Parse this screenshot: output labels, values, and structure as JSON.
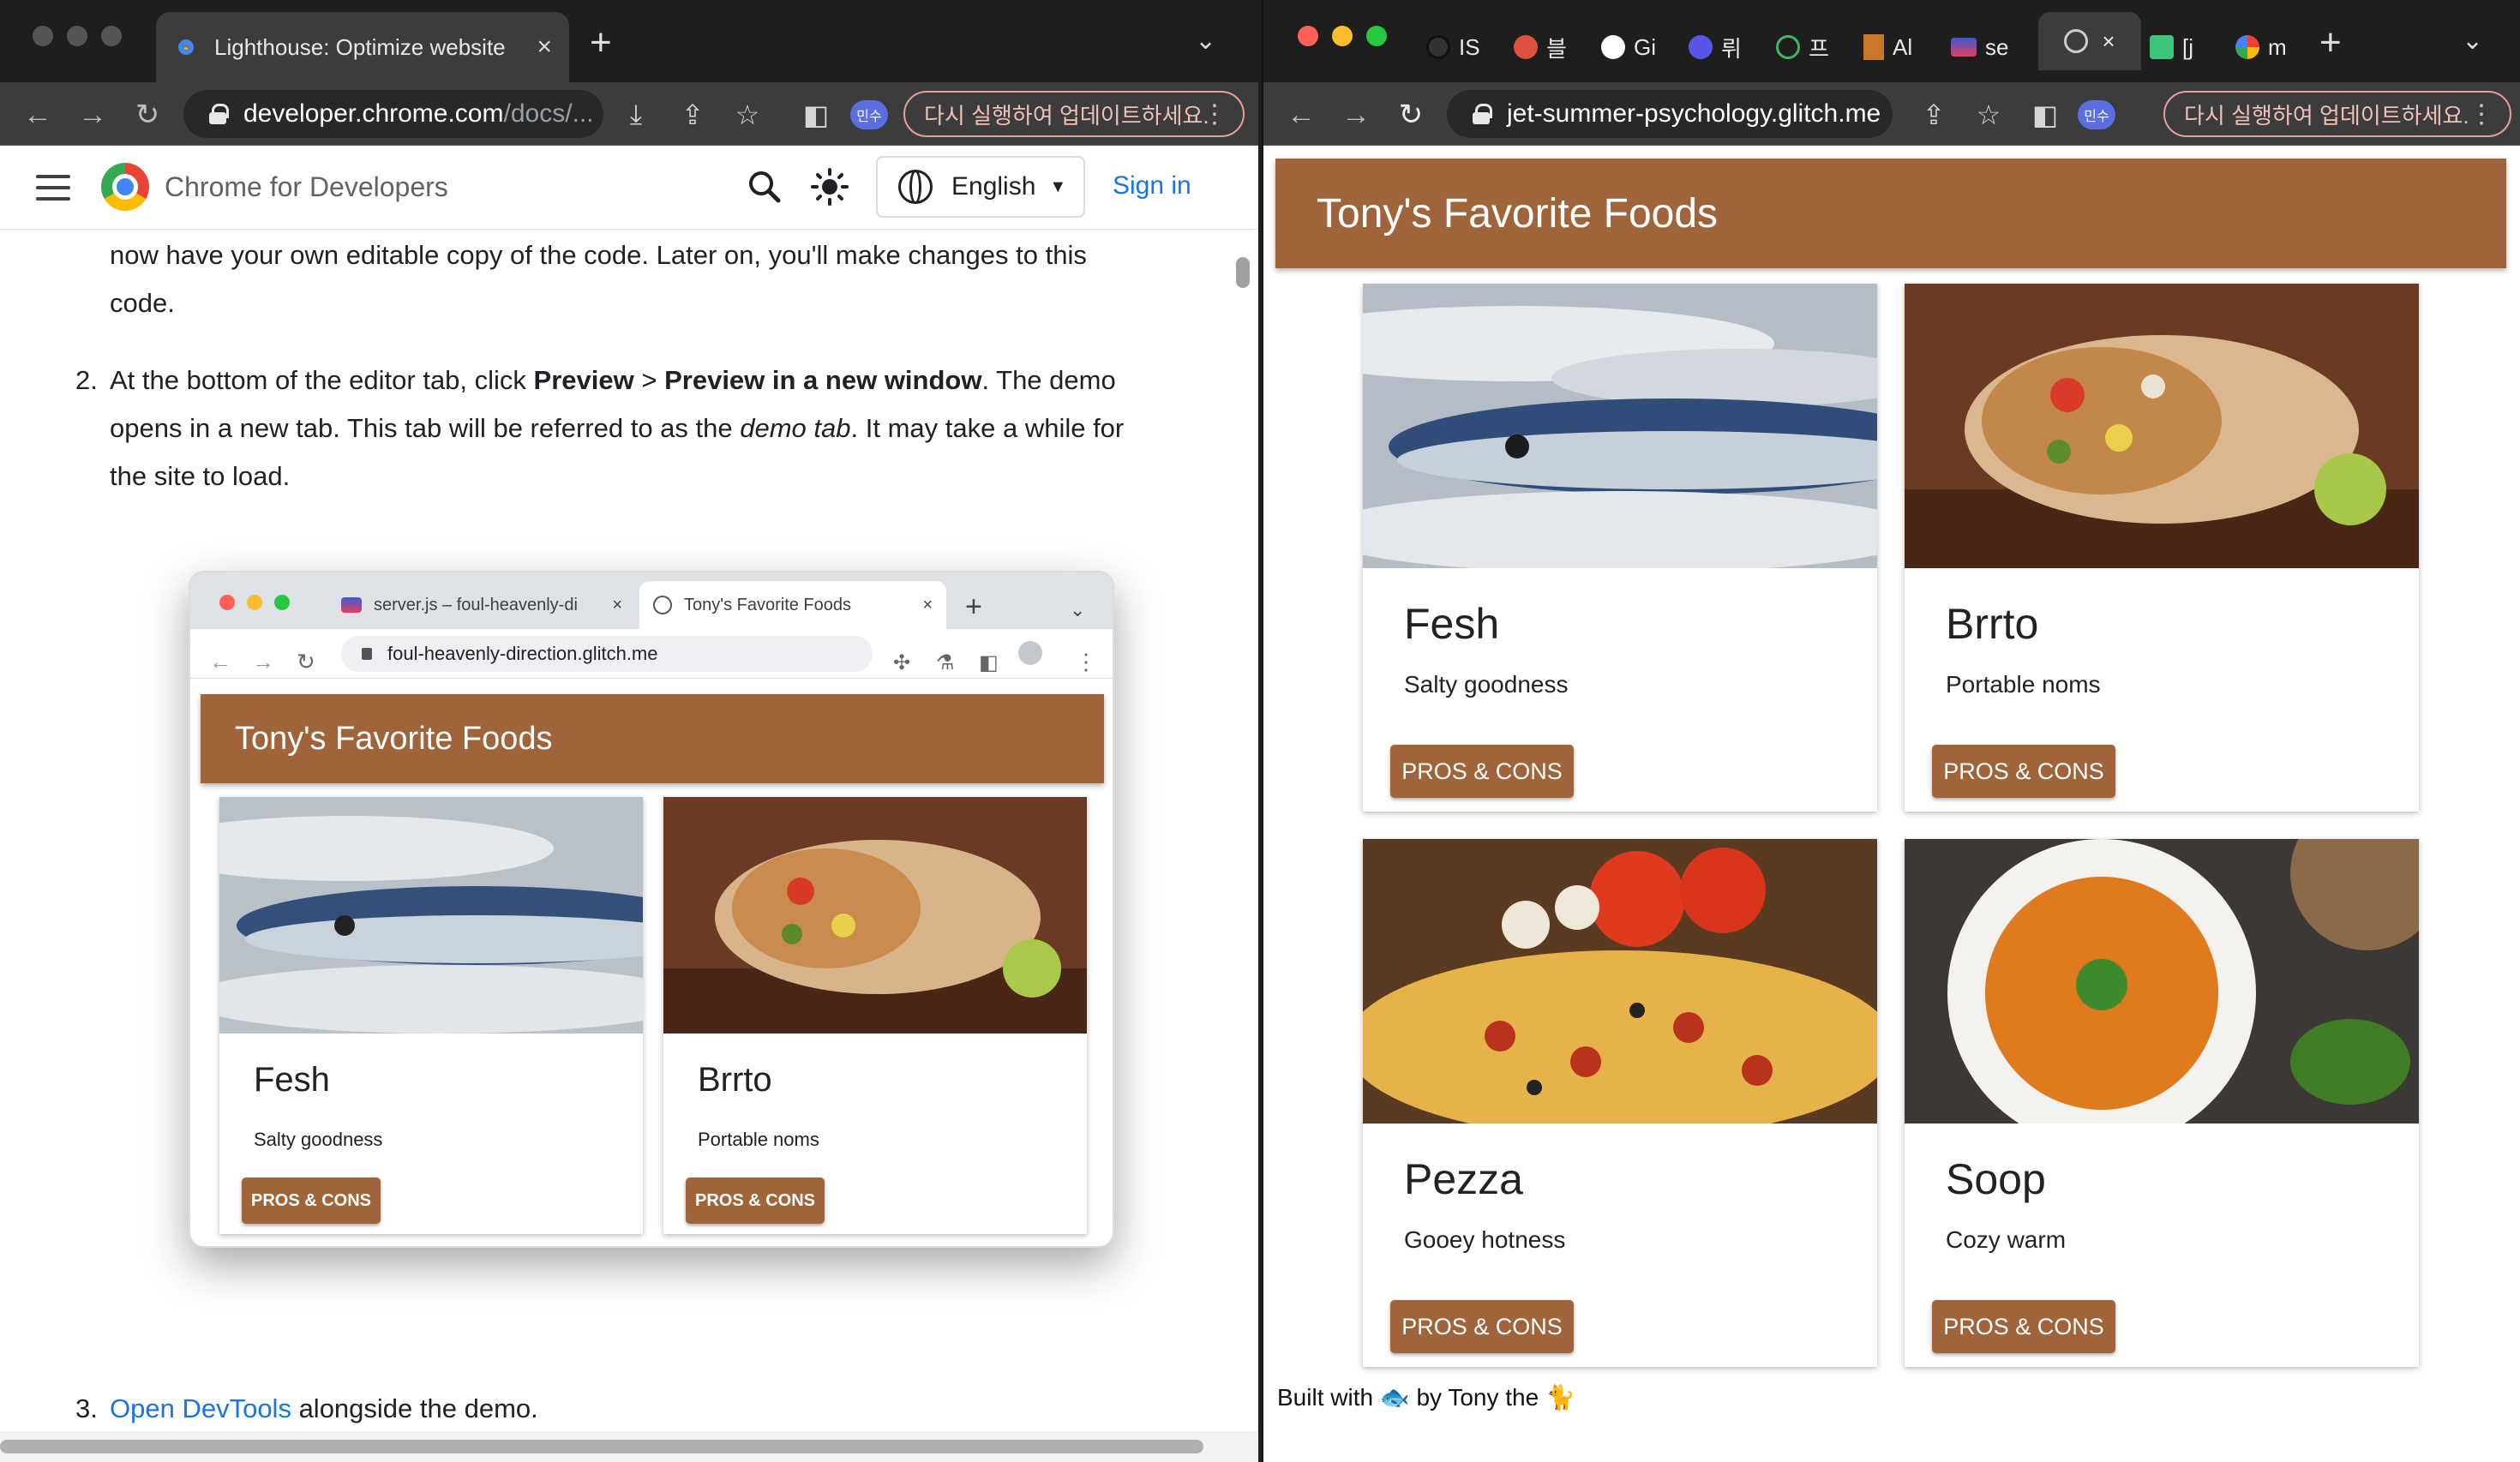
{
  "left_window": {
    "tab": {
      "title": "Lighthouse: Optimize website",
      "close": "×"
    },
    "new_tab": "+",
    "url": {
      "host": "developer.chrome.com",
      "path": "/docs/..."
    },
    "profile": "민수",
    "update_chip": "다시 실행하여 업데이트하세요.",
    "site": {
      "brand": "Chrome for Developers",
      "language": "English",
      "sign_in": "Sign in"
    },
    "doc": {
      "line_top": "now have your own editable copy of the code. Later on, you'll make changes to this",
      "line_top2": "code.",
      "step2_num": "2.",
      "step2_a": "At the bottom of the editor tab, click ",
      "step2_b": "Preview",
      "step2_c": " > ",
      "step2_d": "Preview in a new window",
      "step2_e": ". The demo",
      "step2_line2_a": "opens in a new tab. This tab will be referred to as the ",
      "step2_line2_b": "demo tab",
      "step2_line2_c": ". It may take a while for",
      "step2_line3": "the site to load.",
      "step3_num": "3.",
      "step3_link": "Open DevTools",
      "step3_rest": " alongside the demo."
    },
    "screenshot": {
      "tab1": "server.js – foul-heavenly-di",
      "tab2": "Tony's Favorite Foods",
      "url": "foul-heavenly-direction.glitch.me",
      "header": "Tony's Favorite Foods",
      "cards": [
        {
          "title": "Fesh",
          "desc": "Salty goodness",
          "button": "PROS & CONS"
        },
        {
          "title": "Brrto",
          "desc": "Portable noms",
          "button": "PROS & CONS"
        }
      ]
    }
  },
  "right_window": {
    "tabs": [
      "IS",
      "블",
      "Gi",
      "뤼",
      "프",
      "Al",
      "se",
      "",
      "[j",
      "m"
    ],
    "new_tab": "+",
    "url": "jet-summer-psychology.glitch.me",
    "profile": "민수",
    "update_chip": "다시 실행하여 업데이트하세요.",
    "app": {
      "header": "Tony's Favorite Foods",
      "cards": [
        {
          "title": "Fesh",
          "desc": "Salty goodness",
          "button": "PROS & CONS"
        },
        {
          "title": "Brrto",
          "desc": "Portable noms",
          "button": "PROS & CONS"
        },
        {
          "title": "Pezza",
          "desc": "Gooey hotness",
          "button": "PROS & CONS"
        },
        {
          "title": "Soop",
          "desc": "Cozy warm",
          "button": "PROS & CONS"
        }
      ],
      "footer": {
        "prefix": "Built with ",
        "middle": " by Tony the ",
        "icon1": "🐟",
        "icon2": "🐈"
      }
    }
  },
  "colors": {
    "brown": "#a0643a",
    "link": "#1a73e8",
    "tab_dark": "#1e1e1e",
    "toolbar_dark": "#3c3c3c"
  }
}
